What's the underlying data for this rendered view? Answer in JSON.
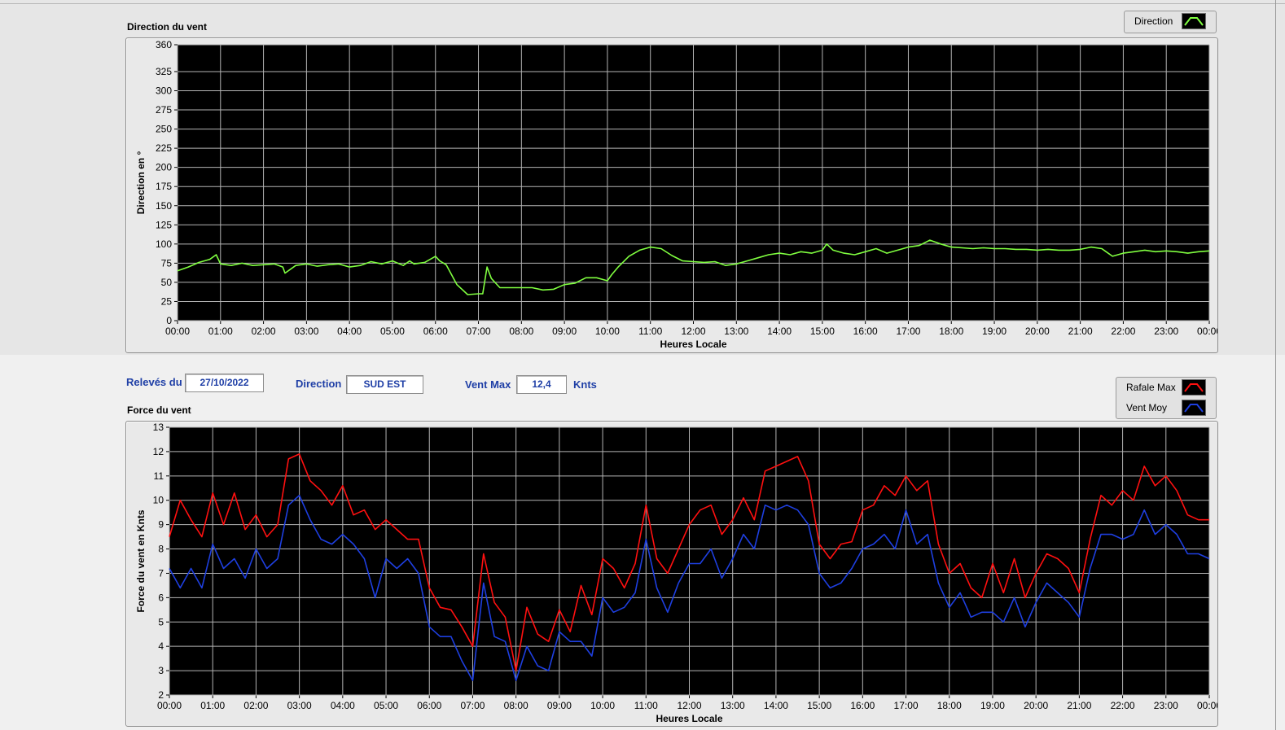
{
  "top_chart": {
    "title": "Direction du vent",
    "legend": [
      {
        "label": "Direction",
        "color": "#80ff40"
      }
    ]
  },
  "controls": {
    "date_label": "Relevés du",
    "date_value": "27/10/2022",
    "direction_label": "Direction",
    "direction_value": "SUD EST",
    "vmax_label": "Vent Max",
    "vmax_value": "12,4",
    "vmax_unit": "Knts"
  },
  "bottom_chart": {
    "title": "Force du vent",
    "legend": [
      {
        "label": "Rafale Max",
        "color": "#ff1010"
      },
      {
        "label": "Vent Moy",
        "color": "#1e3fe0"
      }
    ]
  },
  "chart_data": [
    {
      "type": "line",
      "title": "",
      "xlabel": "Heures Locale",
      "ylabel": "Direction en °",
      "xlim": [
        0,
        24
      ],
      "ylim": [
        0,
        360
      ],
      "x_ticks": [
        "00:00",
        "01:00",
        "02:00",
        "03:00",
        "04:00",
        "05:00",
        "06:00",
        "07:00",
        "08:00",
        "09:00",
        "10:00",
        "11:00",
        "12:00",
        "13:00",
        "14:00",
        "15:00",
        "16:00",
        "17:00",
        "18:00",
        "19:00",
        "20:00",
        "21:00",
        "22:00",
        "23:00",
        "00:00"
      ],
      "y_ticks": [
        0,
        25,
        50,
        75,
        100,
        125,
        150,
        175,
        200,
        225,
        250,
        275,
        300,
        325,
        360
      ],
      "grid": true,
      "legend_position": "top-right",
      "series": [
        {
          "name": "Direction",
          "color": "#80ff40",
          "x": [
            0,
            0.25,
            0.5,
            0.75,
            0.9,
            1.0,
            1.25,
            1.5,
            1.75,
            2.0,
            2.25,
            2.45,
            2.5,
            2.75,
            3.0,
            3.25,
            3.5,
            3.75,
            4.0,
            4.25,
            4.5,
            4.75,
            5.0,
            5.25,
            5.4,
            5.5,
            5.75,
            6.0,
            6.1,
            6.25,
            6.5,
            6.75,
            7.0,
            7.1,
            7.2,
            7.3,
            7.5,
            7.75,
            8.0,
            8.25,
            8.5,
            8.75,
            9.0,
            9.25,
            9.5,
            9.75,
            10.0,
            10.1,
            10.25,
            10.5,
            10.75,
            11.0,
            11.25,
            11.5,
            11.75,
            12.0,
            12.25,
            12.5,
            12.75,
            13.0,
            13.25,
            13.5,
            13.75,
            14.0,
            14.25,
            14.5,
            14.75,
            15.0,
            15.1,
            15.25,
            15.5,
            15.75,
            16.0,
            16.25,
            16.5,
            16.75,
            17.0,
            17.25,
            17.5,
            17.75,
            18.0,
            18.25,
            18.5,
            18.75,
            19.0,
            19.25,
            19.5,
            19.75,
            20.0,
            20.25,
            20.5,
            20.75,
            21.0,
            21.25,
            21.5,
            21.6,
            21.75,
            22.0,
            22.25,
            22.5,
            22.75,
            23.0,
            23.25,
            23.5,
            23.75,
            24.0
          ],
          "y": [
            65,
            70,
            76,
            80,
            86,
            74,
            72,
            75,
            72,
            73,
            74,
            70,
            62,
            72,
            74,
            71,
            73,
            74,
            70,
            72,
            77,
            74,
            78,
            72,
            78,
            74,
            76,
            84,
            78,
            73,
            47,
            34,
            35,
            35,
            70,
            55,
            43,
            43,
            43,
            43,
            40,
            41,
            47,
            49,
            56,
            56,
            52,
            60,
            70,
            84,
            92,
            96,
            94,
            85,
            78,
            77,
            76,
            77,
            72,
            74,
            78,
            82,
            86,
            88,
            86,
            90,
            88,
            92,
            100,
            92,
            88,
            86,
            90,
            94,
            88,
            92,
            96,
            98,
            105,
            100,
            96,
            95,
            94,
            95,
            94,
            94,
            93,
            93,
            92,
            93,
            92,
            92,
            93,
            96,
            94,
            90,
            84,
            88,
            90,
            92,
            90,
            91,
            90,
            88,
            90,
            91
          ]
        }
      ]
    },
    {
      "type": "line",
      "title": "",
      "xlabel": "Heures Locale",
      "ylabel": "Force du vent en Knts",
      "xlim": [
        0,
        24
      ],
      "ylim": [
        2,
        13
      ],
      "x_ticks": [
        "00:00",
        "01:00",
        "02:00",
        "03:00",
        "04:00",
        "05:00",
        "06:00",
        "07:00",
        "08:00",
        "09:00",
        "10:00",
        "11:00",
        "12:00",
        "13:00",
        "14:00",
        "15:00",
        "16:00",
        "17:00",
        "18:00",
        "19:00",
        "20:00",
        "21:00",
        "22:00",
        "23:00",
        "00:00"
      ],
      "y_ticks": [
        2,
        3,
        4,
        5,
        6,
        7,
        8,
        9,
        10,
        11,
        12,
        13
      ],
      "grid": true,
      "legend_position": "top-right",
      "series": [
        {
          "name": "Rafale Max",
          "color": "#ff1010",
          "x": [
            0,
            0.25,
            0.5,
            0.75,
            1.0,
            1.25,
            1.5,
            1.75,
            2.0,
            2.25,
            2.5,
            2.75,
            3.0,
            3.25,
            3.5,
            3.75,
            4.0,
            4.25,
            4.5,
            4.75,
            5.0,
            5.25,
            5.5,
            5.75,
            6.0,
            6.25,
            6.5,
            6.75,
            7.0,
            7.25,
            7.5,
            7.75,
            8.0,
            8.25,
            8.5,
            8.75,
            9.0,
            9.25,
            9.5,
            9.75,
            10.0,
            10.25,
            10.5,
            10.75,
            11.0,
            11.25,
            11.5,
            11.75,
            12.0,
            12.25,
            12.5,
            12.75,
            13.0,
            13.25,
            13.5,
            13.75,
            14.0,
            14.25,
            14.5,
            14.75,
            15.0,
            15.25,
            15.5,
            15.75,
            16.0,
            16.25,
            16.5,
            16.75,
            17.0,
            17.25,
            17.5,
            17.75,
            18.0,
            18.25,
            18.5,
            18.75,
            19.0,
            19.25,
            19.5,
            19.75,
            20.0,
            20.25,
            20.5,
            20.75,
            21.0,
            21.25,
            21.5,
            21.75,
            22.0,
            22.25,
            22.5,
            22.75,
            23.0,
            23.25,
            23.5,
            23.75,
            24.0
          ],
          "y": [
            8.5,
            10.0,
            9.2,
            8.5,
            10.3,
            9.0,
            10.3,
            8.8,
            9.4,
            8.5,
            9.0,
            11.7,
            11.9,
            10.8,
            10.4,
            9.8,
            10.6,
            9.4,
            9.6,
            8.8,
            9.2,
            8.8,
            8.4,
            8.4,
            6.4,
            5.6,
            5.5,
            4.8,
            4.0,
            7.8,
            5.8,
            5.2,
            3.0,
            5.6,
            4.5,
            4.2,
            5.5,
            4.6,
            6.5,
            5.3,
            7.6,
            7.2,
            6.4,
            7.4,
            9.8,
            7.6,
            7.0,
            8.0,
            9.0,
            9.6,
            9.8,
            8.6,
            9.2,
            10.1,
            9.2,
            11.2,
            11.4,
            11.6,
            11.8,
            10.8,
            8.2,
            7.6,
            8.2,
            8.3,
            9.6,
            9.8,
            10.6,
            10.2,
            11.0,
            10.4,
            10.8,
            8.2,
            7.0,
            7.4,
            6.4,
            6.0,
            7.4,
            6.2,
            7.6,
            6.0,
            7.0,
            7.8,
            7.6,
            7.2,
            6.2,
            8.4,
            10.2,
            9.8,
            10.4,
            10.0,
            11.4,
            10.6,
            11.0,
            10.4,
            9.4,
            9.2,
            9.2
          ]
        },
        {
          "name": "Vent Moy",
          "color": "#1e3fe0",
          "x": [
            0,
            0.25,
            0.5,
            0.75,
            1.0,
            1.25,
            1.5,
            1.75,
            2.0,
            2.25,
            2.5,
            2.75,
            3.0,
            3.25,
            3.5,
            3.75,
            4.0,
            4.25,
            4.5,
            4.75,
            5.0,
            5.25,
            5.5,
            5.75,
            6.0,
            6.25,
            6.5,
            6.75,
            7.0,
            7.25,
            7.5,
            7.75,
            8.0,
            8.25,
            8.5,
            8.75,
            9.0,
            9.25,
            9.5,
            9.75,
            10.0,
            10.25,
            10.5,
            10.75,
            11.0,
            11.25,
            11.5,
            11.75,
            12.0,
            12.25,
            12.5,
            12.75,
            13.0,
            13.25,
            13.5,
            13.75,
            14.0,
            14.25,
            14.5,
            14.75,
            15.0,
            15.25,
            15.5,
            15.75,
            16.0,
            16.25,
            16.5,
            16.75,
            17.0,
            17.25,
            17.5,
            17.75,
            18.0,
            18.25,
            18.5,
            18.75,
            19.0,
            19.25,
            19.5,
            19.75,
            20.0,
            20.25,
            20.5,
            20.75,
            21.0,
            21.25,
            21.5,
            21.75,
            22.0,
            22.25,
            22.5,
            22.75,
            23.0,
            23.25,
            23.5,
            23.75,
            24.0
          ],
          "y": [
            7.2,
            6.4,
            7.2,
            6.4,
            8.2,
            7.2,
            7.6,
            6.8,
            8.0,
            7.2,
            7.6,
            9.8,
            10.2,
            9.2,
            8.4,
            8.2,
            8.6,
            8.2,
            7.6,
            6.0,
            7.6,
            7.2,
            7.6,
            7.0,
            4.8,
            4.4,
            4.4,
            3.4,
            2.6,
            6.6,
            4.4,
            4.2,
            2.6,
            4.0,
            3.2,
            3.0,
            4.6,
            4.2,
            4.2,
            3.6,
            6.0,
            5.4,
            5.6,
            6.2,
            8.4,
            6.4,
            5.4,
            6.6,
            7.4,
            7.4,
            8.0,
            6.8,
            7.6,
            8.6,
            8.0,
            9.8,
            9.6,
            9.8,
            9.6,
            9.0,
            7.0,
            6.4,
            6.6,
            7.2,
            8.0,
            8.2,
            8.6,
            8.0,
            9.6,
            8.2,
            8.6,
            6.6,
            5.6,
            6.2,
            5.2,
            5.4,
            5.4,
            5.0,
            6.0,
            4.8,
            5.8,
            6.6,
            6.2,
            5.8,
            5.2,
            7.2,
            8.6,
            8.6,
            8.4,
            8.6,
            9.6,
            8.6,
            9.0,
            8.6,
            7.8,
            7.8,
            7.6
          ]
        }
      ]
    }
  ]
}
